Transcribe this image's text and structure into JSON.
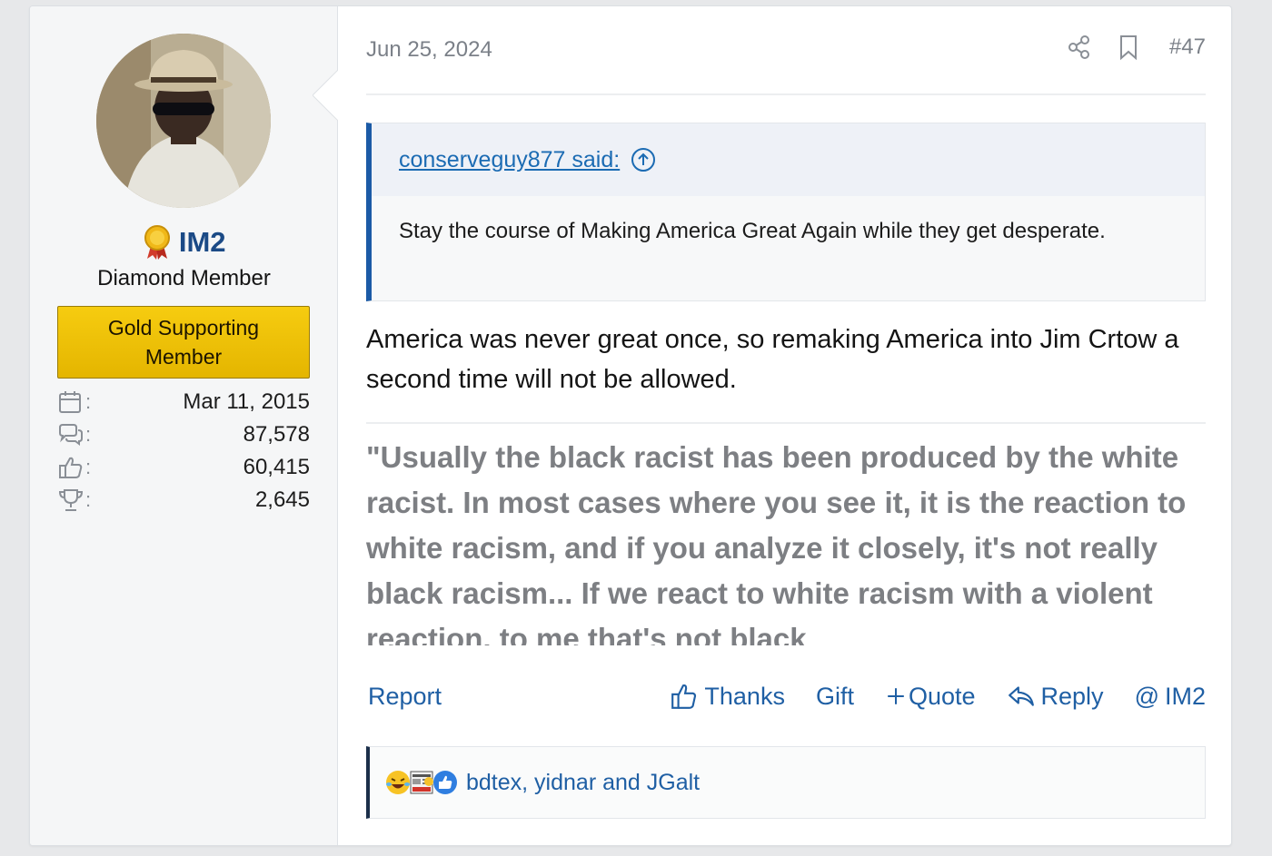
{
  "user": {
    "name": "IM2",
    "title": "Diamond Member",
    "banner": "Gold Supporting Member",
    "stats": [
      {
        "icon": "calendar-icon",
        "value": "Mar 11, 2015"
      },
      {
        "icon": "messages-icon",
        "value": "87,578"
      },
      {
        "icon": "thumbs-up-icon",
        "value": "60,415"
      },
      {
        "icon": "trophy-icon",
        "value": "2,645"
      }
    ]
  },
  "post": {
    "date": "Jun 25, 2024",
    "number": "#47",
    "quote": {
      "author": "conserveguy877 said:",
      "text": "Stay the course of Making America Great Again while they get desperate."
    },
    "message": "America was never great once, so remaking America into Jim Crtow a second time will not be allowed.",
    "signature": "\"Usually the black racist has been produced by the white racist. In most cases where you see it, it is the reaction to white racism, and if you analyze it closely, it's not really black racism... If we react to white racism with a violent reaction, to me that's not black"
  },
  "actions": {
    "report": "Report",
    "thanks": "Thanks",
    "gift": "Gift",
    "quote": "Quote",
    "reply": "Reply",
    "mention": "IM2"
  },
  "reactions": {
    "text": "bdtex, yidnar and JGalt",
    "icons": [
      "laughing-emoji-icon",
      "fake-news-icon",
      "like-icon"
    ]
  },
  "colors": {
    "link": "#1f5fa4",
    "username": "#1b4a86",
    "banner": "#f2c40a",
    "quote_border": "#1b5aa6"
  }
}
